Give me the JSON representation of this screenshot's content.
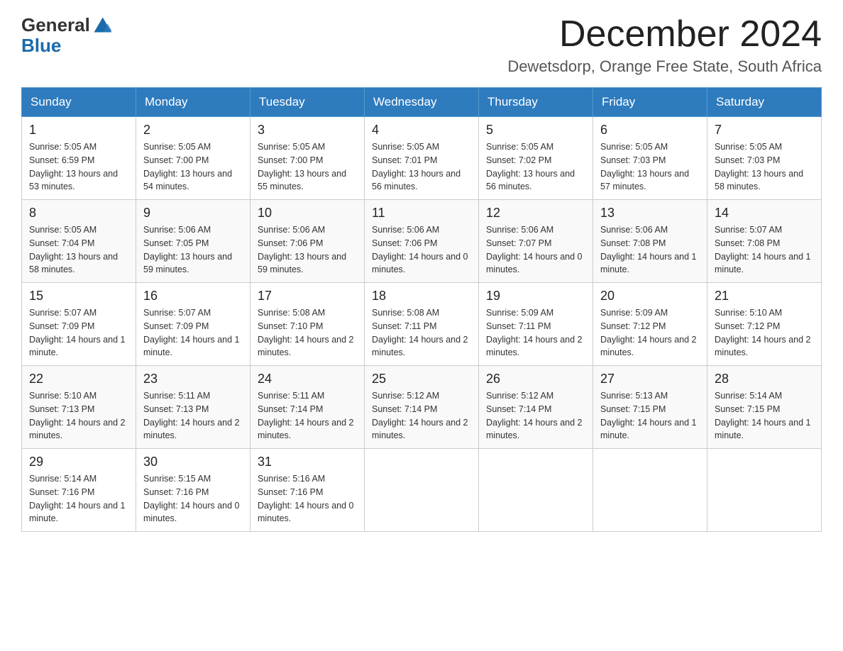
{
  "header": {
    "logo_general": "General",
    "logo_blue": "Blue",
    "month_title": "December 2024",
    "location": "Dewetsdorp, Orange Free State, South Africa"
  },
  "weekdays": [
    "Sunday",
    "Monday",
    "Tuesday",
    "Wednesday",
    "Thursday",
    "Friday",
    "Saturday"
  ],
  "weeks": [
    [
      {
        "day": "1",
        "sunrise": "5:05 AM",
        "sunset": "6:59 PM",
        "daylight": "13 hours and 53 minutes."
      },
      {
        "day": "2",
        "sunrise": "5:05 AM",
        "sunset": "7:00 PM",
        "daylight": "13 hours and 54 minutes."
      },
      {
        "day": "3",
        "sunrise": "5:05 AM",
        "sunset": "7:00 PM",
        "daylight": "13 hours and 55 minutes."
      },
      {
        "day": "4",
        "sunrise": "5:05 AM",
        "sunset": "7:01 PM",
        "daylight": "13 hours and 56 minutes."
      },
      {
        "day": "5",
        "sunrise": "5:05 AM",
        "sunset": "7:02 PM",
        "daylight": "13 hours and 56 minutes."
      },
      {
        "day": "6",
        "sunrise": "5:05 AM",
        "sunset": "7:03 PM",
        "daylight": "13 hours and 57 minutes."
      },
      {
        "day": "7",
        "sunrise": "5:05 AM",
        "sunset": "7:03 PM",
        "daylight": "13 hours and 58 minutes."
      }
    ],
    [
      {
        "day": "8",
        "sunrise": "5:05 AM",
        "sunset": "7:04 PM",
        "daylight": "13 hours and 58 minutes."
      },
      {
        "day": "9",
        "sunrise": "5:06 AM",
        "sunset": "7:05 PM",
        "daylight": "13 hours and 59 minutes."
      },
      {
        "day": "10",
        "sunrise": "5:06 AM",
        "sunset": "7:06 PM",
        "daylight": "13 hours and 59 minutes."
      },
      {
        "day": "11",
        "sunrise": "5:06 AM",
        "sunset": "7:06 PM",
        "daylight": "14 hours and 0 minutes."
      },
      {
        "day": "12",
        "sunrise": "5:06 AM",
        "sunset": "7:07 PM",
        "daylight": "14 hours and 0 minutes."
      },
      {
        "day": "13",
        "sunrise": "5:06 AM",
        "sunset": "7:08 PM",
        "daylight": "14 hours and 1 minute."
      },
      {
        "day": "14",
        "sunrise": "5:07 AM",
        "sunset": "7:08 PM",
        "daylight": "14 hours and 1 minute."
      }
    ],
    [
      {
        "day": "15",
        "sunrise": "5:07 AM",
        "sunset": "7:09 PM",
        "daylight": "14 hours and 1 minute."
      },
      {
        "day": "16",
        "sunrise": "5:07 AM",
        "sunset": "7:09 PM",
        "daylight": "14 hours and 1 minute."
      },
      {
        "day": "17",
        "sunrise": "5:08 AM",
        "sunset": "7:10 PM",
        "daylight": "14 hours and 2 minutes."
      },
      {
        "day": "18",
        "sunrise": "5:08 AM",
        "sunset": "7:11 PM",
        "daylight": "14 hours and 2 minutes."
      },
      {
        "day": "19",
        "sunrise": "5:09 AM",
        "sunset": "7:11 PM",
        "daylight": "14 hours and 2 minutes."
      },
      {
        "day": "20",
        "sunrise": "5:09 AM",
        "sunset": "7:12 PM",
        "daylight": "14 hours and 2 minutes."
      },
      {
        "day": "21",
        "sunrise": "5:10 AM",
        "sunset": "7:12 PM",
        "daylight": "14 hours and 2 minutes."
      }
    ],
    [
      {
        "day": "22",
        "sunrise": "5:10 AM",
        "sunset": "7:13 PM",
        "daylight": "14 hours and 2 minutes."
      },
      {
        "day": "23",
        "sunrise": "5:11 AM",
        "sunset": "7:13 PM",
        "daylight": "14 hours and 2 minutes."
      },
      {
        "day": "24",
        "sunrise": "5:11 AM",
        "sunset": "7:14 PM",
        "daylight": "14 hours and 2 minutes."
      },
      {
        "day": "25",
        "sunrise": "5:12 AM",
        "sunset": "7:14 PM",
        "daylight": "14 hours and 2 minutes."
      },
      {
        "day": "26",
        "sunrise": "5:12 AM",
        "sunset": "7:14 PM",
        "daylight": "14 hours and 2 minutes."
      },
      {
        "day": "27",
        "sunrise": "5:13 AM",
        "sunset": "7:15 PM",
        "daylight": "14 hours and 1 minute."
      },
      {
        "day": "28",
        "sunrise": "5:14 AM",
        "sunset": "7:15 PM",
        "daylight": "14 hours and 1 minute."
      }
    ],
    [
      {
        "day": "29",
        "sunrise": "5:14 AM",
        "sunset": "7:16 PM",
        "daylight": "14 hours and 1 minute."
      },
      {
        "day": "30",
        "sunrise": "5:15 AM",
        "sunset": "7:16 PM",
        "daylight": "14 hours and 0 minutes."
      },
      {
        "day": "31",
        "sunrise": "5:16 AM",
        "sunset": "7:16 PM",
        "daylight": "14 hours and 0 minutes."
      },
      null,
      null,
      null,
      null
    ]
  ]
}
